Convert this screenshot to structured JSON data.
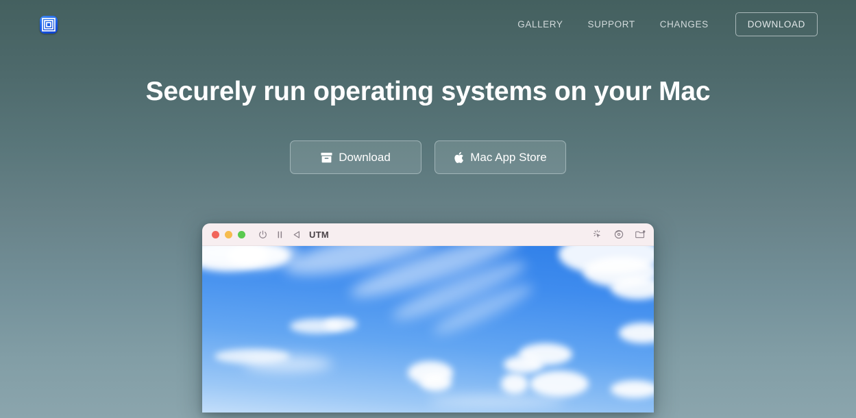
{
  "header": {
    "logo": {
      "icon": "utm-concentric-squares-logo",
      "label": "UTM"
    },
    "nav": [
      {
        "label": "GALLERY",
        "name": "nav-link-gallery"
      },
      {
        "label": "SUPPORT",
        "name": "nav-link-support"
      },
      {
        "label": "CHANGES",
        "name": "nav-link-changes"
      }
    ],
    "download_button": {
      "label": "DOWNLOAD"
    }
  },
  "hero": {
    "title": "Securely run operating systems on your Mac",
    "buttons": [
      {
        "label": "Download",
        "icon": "archive-box-icon",
        "name": "hero-download-button"
      },
      {
        "label": "Mac App Store",
        "icon": "apple-logo-icon",
        "name": "hero-mac-app-store-button"
      }
    ]
  },
  "vm_window": {
    "title": "UTM",
    "traffic_lights": [
      {
        "name": "close",
        "color": "#f1665c"
      },
      {
        "name": "minimize",
        "color": "#f6bc4f"
      },
      {
        "name": "zoom",
        "color": "#5ac94f"
      }
    ],
    "toolbar_left": [
      {
        "icon": "power-icon",
        "name": "vm-power-button"
      },
      {
        "icon": "pause-icon",
        "name": "vm-pause-button"
      },
      {
        "icon": "play-triangle-icon",
        "name": "vm-play-button"
      }
    ],
    "toolbar_right": [
      {
        "icon": "capture-input-cursor-icon",
        "name": "vm-capture-input-button"
      },
      {
        "icon": "disc-drive-icon",
        "name": "vm-drive-button"
      },
      {
        "icon": "shared-folder-icon",
        "name": "vm-shared-folder-button"
      }
    ],
    "screen_content": "blue sky with white clouds wallpaper"
  },
  "colors": {
    "bg_top": "#44605f",
    "bg_bottom": "#8ba5ad",
    "logo_blue": "#1e62e8",
    "titlebar": "#f7eef0",
    "sky_blue": "#3f8cee"
  }
}
